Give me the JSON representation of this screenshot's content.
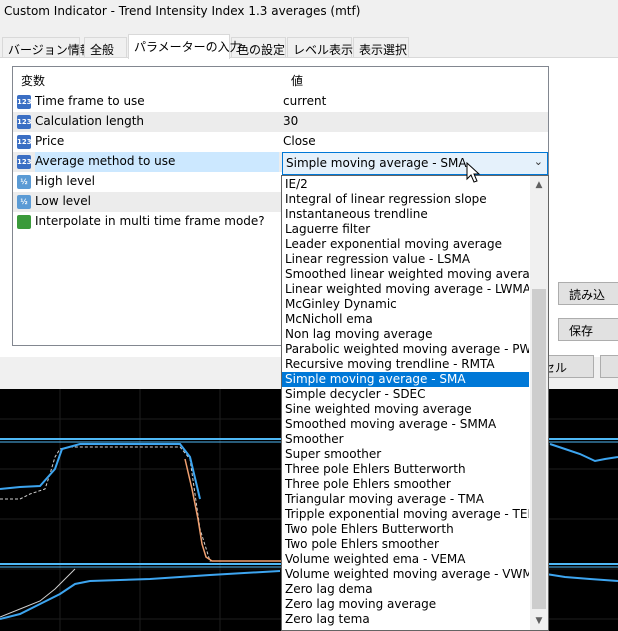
{
  "window": {
    "title": "Custom Indicator - Trend Intensity Index 1.3 averages (mtf)"
  },
  "tabs": [
    {
      "label": "バージョン情報"
    },
    {
      "label": "全般"
    },
    {
      "label": "パラメーターの入力"
    },
    {
      "label": "色の設定"
    },
    {
      "label": "レベル表示"
    },
    {
      "label": "表示選択"
    }
  ],
  "active_tab": "パラメーターの入力",
  "grid": {
    "headers": {
      "variable": "変数",
      "value": "値"
    },
    "rows": [
      {
        "icon": "integer-type-icon",
        "icon_text": "123",
        "variable": "Time frame to use",
        "value": "current"
      },
      {
        "icon": "integer-type-icon",
        "icon_text": "123",
        "variable": "Calculation length",
        "value": "30"
      },
      {
        "icon": "integer-type-icon",
        "icon_text": "123",
        "variable": "Price",
        "value": "Close"
      },
      {
        "icon": "integer-type-icon",
        "icon_text": "123",
        "variable": "Average method to use",
        "value": "Simple moving average - SMA"
      },
      {
        "icon": "double-type-icon",
        "icon_text": "½",
        "variable": "High level",
        "value": ""
      },
      {
        "icon": "double-type-icon",
        "icon_text": "½",
        "variable": "Low level",
        "value": ""
      },
      {
        "icon": "bool-type-icon",
        "icon_text": "",
        "variable": "Interpolate in multi time frame mode?",
        "value": ""
      }
    ]
  },
  "combo": {
    "value": "Simple moving average - SMA"
  },
  "dropdown": {
    "selected": "Simple moving average - SMA",
    "options": [
      "IE/2",
      "Integral of linear regression slope",
      "Instantaneous trendline",
      "Laguerre filter",
      "Leader exponential moving average",
      "Linear regression value - LSMA",
      "Smoothed linear weighted moving average - SL",
      "Linear weighted moving average - LWMA",
      "McGinley Dynamic",
      "McNicholl ema",
      "Non lag moving average",
      "Parabolic weighted moving average - PWMA",
      "Recursive moving trendline - RMTA",
      "Simple moving average - SMA",
      "Simple decycler - SDEC",
      "Sine weighted moving average",
      "Smoothed moving average - SMMA",
      "Smoother",
      "Super smoother",
      "Three pole Ehlers Butterworth",
      "Three pole Ehlers smoother",
      "Triangular moving average - TMA",
      "Tripple exponential moving average - TEMA",
      "Two pole Ehlers Butterworth",
      "Two pole Ehlers smoother",
      "Volume weighted ema - VEMA",
      "Volume weighted moving average - VWMA",
      "Zero lag dema",
      "Zero lag moving average",
      "Zero lag tema"
    ]
  },
  "buttons": {
    "load": "読み込",
    "save": "保存",
    "cancel": "ンセル"
  },
  "colors": {
    "chart_background": "#000000",
    "line_blue": "#3da5f0",
    "line_dashed_white": "#d0d0d0",
    "line_orange": "#f0a070",
    "level_line": "#4fb8f5",
    "selection": "#0078d7"
  }
}
